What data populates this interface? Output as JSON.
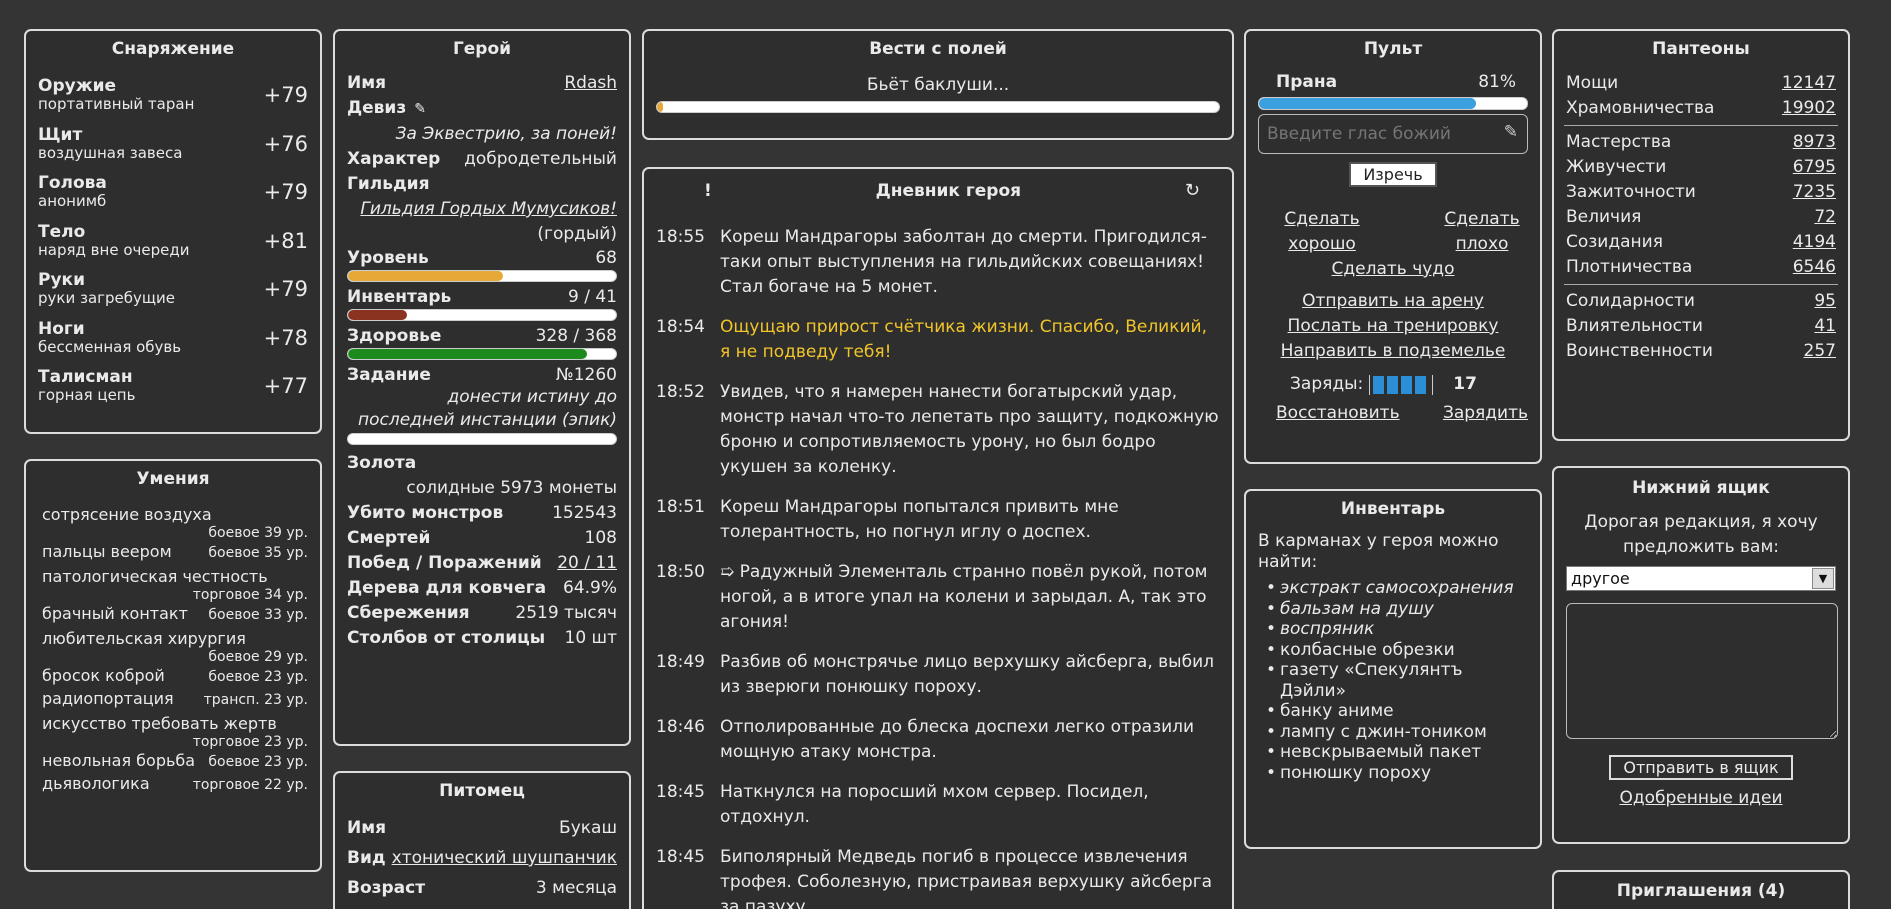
{
  "equipment": {
    "title": "Снаряжение",
    "items": [
      {
        "slot": "Оружие",
        "item": "портативный таран",
        "bonus": "+79"
      },
      {
        "slot": "Щит",
        "item": "воздушная завеса",
        "bonus": "+76"
      },
      {
        "slot": "Голова",
        "item": "анонимб",
        "bonus": "+79"
      },
      {
        "slot": "Тело",
        "item": "наряд вне очереди",
        "bonus": "+81"
      },
      {
        "slot": "Руки",
        "item": "руки загребущие",
        "bonus": "+79"
      },
      {
        "slot": "Ноги",
        "item": "бессменная обувь",
        "bonus": "+78"
      },
      {
        "slot": "Талисман",
        "item": "горная цепь",
        "bonus": "+77"
      }
    ]
  },
  "skills": {
    "title": "Умения",
    "items": [
      {
        "name": "сотрясение воздуха",
        "level": "боевое 39 ур.",
        "inline": false
      },
      {
        "name": "пальцы веером",
        "level": "боевое 35 ур.",
        "inline": true
      },
      {
        "name": "патологическая честность",
        "level": "торговое 34 ур.",
        "inline": false
      },
      {
        "name": "брачный контакт",
        "level": "боевое 33 ур.",
        "inline": true
      },
      {
        "name": "любительская хирургия",
        "level": "боевое 29 ур.",
        "inline": false
      },
      {
        "name": "бросок коброй",
        "level": "боевое 23 ур.",
        "inline": true
      },
      {
        "name": "радиопортация",
        "level": "трансп. 23 ур.",
        "inline": true
      },
      {
        "name": "искусство требовать жертв",
        "level": "торговое 23 ур.",
        "inline": false
      },
      {
        "name": "невольная борьба",
        "level": "боевое 23 ур.",
        "inline": true
      },
      {
        "name": "дьявологика",
        "level": "торговое 22 ур.",
        "inline": true
      }
    ]
  },
  "hero": {
    "title": "Герой",
    "name_label": "Имя",
    "name": "Rdash",
    "motto_label": "Девиз",
    "motto_icon": "pencil-icon",
    "motto": "За Эквестрию, за поней!",
    "character_label": "Характер",
    "character": "добродетельный",
    "guild_label": "Гильдия",
    "guild": "Гильдия Гордых Мумусиков!",
    "guild_rank": "(гордый)",
    "level_label": "Уровень",
    "level": "68",
    "level_progress": 0.58,
    "inventory_label": "Инвентарь",
    "inventory": "9 / 41",
    "inventory_fill": 0.22,
    "health_label": "Здоровье",
    "health": "328 / 368",
    "health_fill": 0.89,
    "quest_label": "Задание",
    "quest_no": "№1260",
    "quest": "донести истину до последней инстанции (эпик)",
    "quest_progress": 0.0,
    "gold_label": "Золота",
    "gold": "солидные 5973 монеты",
    "kills_label": "Убито монстров",
    "kills": "152543",
    "deaths_label": "Смертей",
    "deaths": "108",
    "wl_label": "Побед / Поражений",
    "wl": "20 / 11",
    "ark_label": "Дерева для ковчега",
    "ark": "64.9%",
    "savings_label": "Сбережения",
    "savings": "2519 тысяч",
    "pillars_label": "Столбов от столицы",
    "pillars": "10 шт"
  },
  "pet": {
    "title": "Питомец",
    "name_label": "Имя",
    "name": "Букаш",
    "kind_label": "Вид",
    "kind": "хтонический шушпанчик",
    "age_label": "Возраст",
    "age": "3 месяца"
  },
  "news": {
    "title": "Вести с полей",
    "status": "Бьёт баклуши...",
    "progress": 0.01
  },
  "diary": {
    "title": "Дневник героя",
    "left_mark": "!",
    "refresh_icon": "refresh-icon",
    "entries": [
      {
        "time": "18:55",
        "text": "Кореш Мандрагоры заболтан до смерти. Пригодился-таки опыт выступления на гильдийских совещаниях! Стал богаче на 5 монет.",
        "highlight": false
      },
      {
        "time": "18:54",
        "text": "Ощущаю прирост счётчика жизни. Спасибо, Великий, я не подведу тебя!",
        "highlight": true
      },
      {
        "time": "18:52",
        "text": "Увидев, что я намерен нанести богатырский удар, монстр начал что-то лепетать про защиту, подкожную броню и сопротивляемость урону, но был бодро укушен за коленку.",
        "highlight": false
      },
      {
        "time": "18:51",
        "text": "Кореш Мандрагоры попытался привить мне толерантность, но погнул иглу о доспех.",
        "highlight": false
      },
      {
        "time": "18:50",
        "text": "➯ Радужный Элементаль странно повёл рукой, потом ногой, а в итоге упал на колени и зарыдал. А, так это агония!",
        "highlight": false
      },
      {
        "time": "18:49",
        "text": "Разбив об монстрячье лицо верхушку айсберга, выбил из зверюги понюшку пороху.",
        "highlight": false
      },
      {
        "time": "18:46",
        "text": "Отполированные до блеска доспехи легко отразили мощную атаку монстра.",
        "highlight": false
      },
      {
        "time": "18:45",
        "text": "Наткнулся на поросший мхом сервер. Посидел, отдохнул.",
        "highlight": false
      },
      {
        "time": "18:45",
        "text": "Биполярный Медведь погиб в процессе извлечения трофея. Соболезную, пристраивая верхушку айсберга за пазуху.",
        "highlight": false
      }
    ]
  },
  "remote": {
    "title": "Пульт",
    "prana_label": "Прана",
    "prana": "81%",
    "prana_fill": 0.81,
    "voice_placeholder": "Введите глас божий",
    "say_button": "Изречь",
    "do_good": "Сделать хорошо",
    "do_bad": "Сделать плохо",
    "miracle": "Сделать чудо",
    "arena": "Отправить на арену",
    "training": "Послать на тренировку",
    "dungeon": "Направить в подземелье",
    "charges_label": "Заряды:",
    "charges": "17",
    "charge_cells": 4,
    "restore": "Восстановить",
    "charge": "Зарядить"
  },
  "inventory": {
    "title": "Инвентарь",
    "intro": "В карманах у героя можно найти:",
    "items": [
      {
        "name": "экстракт самосохранения",
        "italic": true
      },
      {
        "name": "бальзам на душу",
        "italic": true
      },
      {
        "name": "воспряник",
        "italic": true
      },
      {
        "name": "колбасные обрезки",
        "italic": false
      },
      {
        "name": "газету «Спекулянтъ Дэйли»",
        "italic": false
      },
      {
        "name": "банку аниме",
        "italic": false
      },
      {
        "name": "лампу с джин-тоником",
        "italic": false
      },
      {
        "name": "невскрываемый пакет",
        "italic": false
      },
      {
        "name": "понюшку пороху",
        "italic": false
      }
    ]
  },
  "pantheons": {
    "title": "Пантеоны",
    "groups": [
      [
        {
          "name": "Мощи",
          "rank": "12147"
        },
        {
          "name": "Храмовничества",
          "rank": "19902"
        }
      ],
      [
        {
          "name": "Мастерства",
          "rank": "8973"
        },
        {
          "name": "Живучести",
          "rank": "6795"
        },
        {
          "name": "Зажиточности",
          "rank": "7235"
        },
        {
          "name": "Величия",
          "rank": "72"
        },
        {
          "name": "Созидания",
          "rank": "4194"
        },
        {
          "name": "Плотничества",
          "rank": "6546"
        }
      ],
      [
        {
          "name": "Солидарности",
          "rank": "95"
        },
        {
          "name": "Влиятельности",
          "rank": "41"
        },
        {
          "name": "Воинственности",
          "rank": "257"
        }
      ]
    ]
  },
  "mailbox": {
    "title": "Нижний ящик",
    "intro": "Дорогая редакция, я хочу предложить вам:",
    "select_value": "другое",
    "send_button": "Отправить в ящик",
    "approved_link": "Одобренные идеи"
  },
  "invites": {
    "title": "Приглашения (4)"
  }
}
